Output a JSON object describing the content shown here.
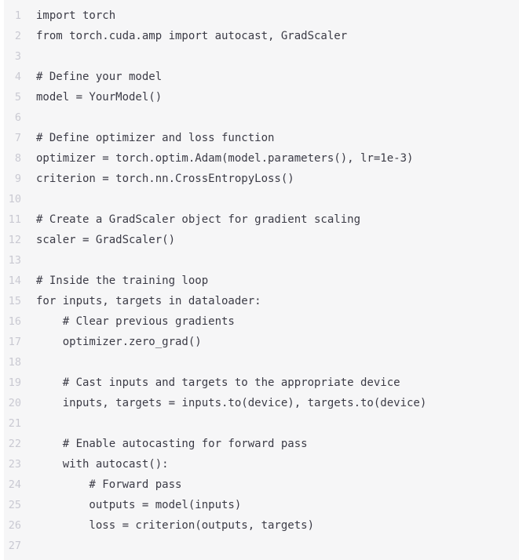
{
  "editor": {
    "language": "python",
    "background_color": "#f6f6f7",
    "text_color": "#3b3b46",
    "line_number_color": "#c9c9d2",
    "gutter_color": "#ffffff",
    "syntax_highlighting": "none",
    "first_line_number": 1,
    "total_lines": 27,
    "lines": [
      {
        "number": "1",
        "text": "import torch"
      },
      {
        "number": "2",
        "text": "from torch.cuda.amp import autocast, GradScaler"
      },
      {
        "number": "3",
        "text": ""
      },
      {
        "number": "4",
        "text": "# Define your model"
      },
      {
        "number": "5",
        "text": "model = YourModel()"
      },
      {
        "number": "6",
        "text": ""
      },
      {
        "number": "7",
        "text": "# Define optimizer and loss function"
      },
      {
        "number": "8",
        "text": "optimizer = torch.optim.Adam(model.parameters(), lr=1e-3)"
      },
      {
        "number": "9",
        "text": "criterion = torch.nn.CrossEntropyLoss()"
      },
      {
        "number": "10",
        "text": ""
      },
      {
        "number": "11",
        "text": "# Create a GradScaler object for gradient scaling"
      },
      {
        "number": "12",
        "text": "scaler = GradScaler()"
      },
      {
        "number": "13",
        "text": ""
      },
      {
        "number": "14",
        "text": "# Inside the training loop"
      },
      {
        "number": "15",
        "text": "for inputs, targets in dataloader:"
      },
      {
        "number": "16",
        "text": "    # Clear previous gradients"
      },
      {
        "number": "17",
        "text": "    optimizer.zero_grad()"
      },
      {
        "number": "18",
        "text": ""
      },
      {
        "number": "19",
        "text": "    # Cast inputs and targets to the appropriate device"
      },
      {
        "number": "20",
        "text": "    inputs, targets = inputs.to(device), targets.to(device)"
      },
      {
        "number": "21",
        "text": ""
      },
      {
        "number": "22",
        "text": "    # Enable autocasting for forward pass"
      },
      {
        "number": "23",
        "text": "    with autocast():"
      },
      {
        "number": "24",
        "text": "        # Forward pass"
      },
      {
        "number": "25",
        "text": "        outputs = model(inputs)"
      },
      {
        "number": "26",
        "text": "        loss = criterion(outputs, targets)"
      },
      {
        "number": "27",
        "text": ""
      }
    ]
  }
}
